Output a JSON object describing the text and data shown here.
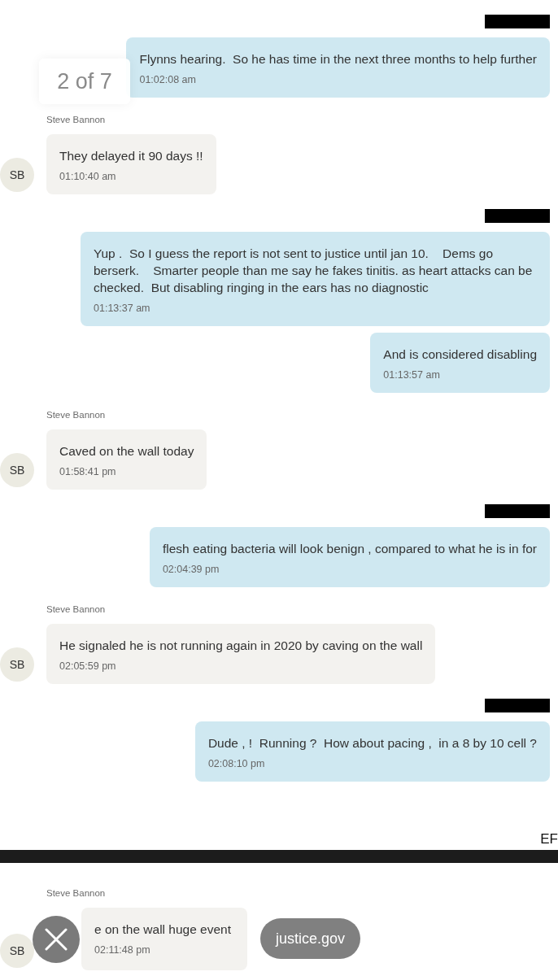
{
  "viewer": {
    "page_counter": "2 of 7",
    "url": "justice.gov"
  },
  "pages": [
    {
      "messages": [
        {
          "kind": "outgoing",
          "sender_redacted": true,
          "text": "Flynns hearing.  So he has time in the next three months to help further",
          "time": "01:02:08 am",
          "partly_covered": false
        },
        {
          "kind": "incoming",
          "sender_redacted": false,
          "sender": "Steve Bannon",
          "avatar": "SB",
          "text": "They delayed it 90 days !!",
          "time": "01:10:40 am",
          "partly_covered": false
        },
        {
          "kind": "outgoing",
          "sender_redacted": true,
          "text": "Yup .  So I guess the report is not sent to justice until jan 10.    Dems go berserk.    Smarter people than me say he fakes tinitis. as heart attacks can be checked.  But disabling ringing in the ears has no diagnostic",
          "time": "01:13:37 am",
          "partly_covered": false
        },
        {
          "kind": "outgoing",
          "sender_redacted": false,
          "text": "And is considered disabling",
          "time": "01:13:57 am",
          "partly_covered": false
        },
        {
          "kind": "incoming",
          "sender_redacted": false,
          "sender": "Steve Bannon",
          "avatar": "SB",
          "text": "Caved on the wall today",
          "time": "01:58:41 pm",
          "partly_covered": false
        },
        {
          "kind": "outgoing",
          "sender_redacted": true,
          "text": "flesh eating bacteria will look benign , compared to what he is in for",
          "time": "02:04:39 pm",
          "partly_covered": false
        },
        {
          "kind": "incoming",
          "sender_redacted": false,
          "sender": "Steve Bannon",
          "avatar": "SB",
          "text": "He signaled he is not running again in 2020 by caving on the wall",
          "time": "02:05:59 pm",
          "partly_covered": false
        },
        {
          "kind": "outgoing",
          "sender_redacted": true,
          "text": "Dude , !  Running ?  How about pacing ,  in a 8 by 10 cell ?",
          "time": "02:08:10 pm",
          "partly_covered": false
        }
      ],
      "footer": "EF"
    },
    {
      "messages": [
        {
          "kind": "incoming",
          "sender_redacted": false,
          "sender": "Steve Bannon",
          "avatar": "SB",
          "text": "e on the wall huge event",
          "time": "02:11:48 pm",
          "partly_covered": true
        }
      ]
    }
  ]
}
